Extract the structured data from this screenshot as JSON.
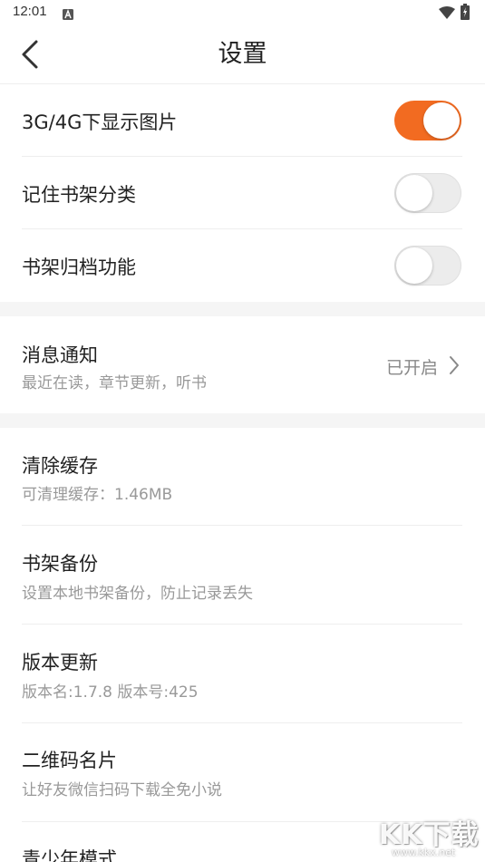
{
  "status_bar": {
    "time": "12:01",
    "app_icon": "a-letter-icon",
    "wifi_icon": "wifi-icon",
    "battery_icon": "battery-charging-icon"
  },
  "header": {
    "title": "设置",
    "back_icon": "chevron-left-icon"
  },
  "toggles": [
    {
      "label": "3G/4G下显示图片",
      "on": true
    },
    {
      "label": "记住书架分类",
      "on": false
    },
    {
      "label": "书架归档功能",
      "on": false
    }
  ],
  "notification": {
    "title": "消息通知",
    "subtitle": "最近在读，章节更新，听书",
    "status": "已开启",
    "chevron_icon": "chevron-right-icon"
  },
  "items": [
    {
      "title": "清除缓存",
      "subtitle": "可清理缓存：1.46MB"
    },
    {
      "title": "书架备份",
      "subtitle": "设置本地书架备份，防止记录丢失"
    },
    {
      "title": "版本更新",
      "subtitle": "版本名:1.7.8  版本号:425"
    },
    {
      "title": "二维码名片",
      "subtitle": "让好友微信扫码下载全免小说"
    },
    {
      "title": "青少年模式"
    }
  ],
  "colors": {
    "accent": "#f26b21",
    "toggle_off": "#ececec",
    "section_gap": "#f5f5f5"
  },
  "watermark": {
    "logo": "KK下载",
    "url": "www.kkx.net"
  }
}
